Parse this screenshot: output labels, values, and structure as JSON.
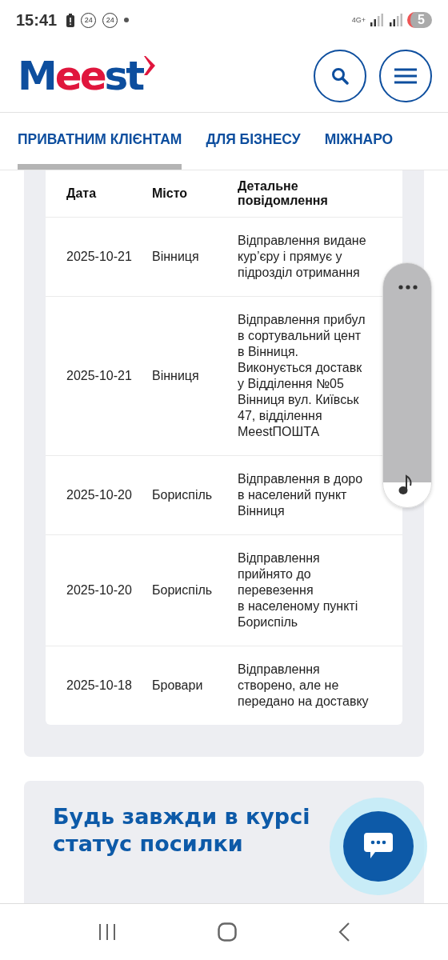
{
  "status_bar": {
    "time": "15:41",
    "badges": [
      "24",
      "24"
    ],
    "network": "4G+",
    "battery": "5"
  },
  "header": {
    "logo_parts": [
      "M",
      "ee",
      "st"
    ]
  },
  "nav_tabs": [
    {
      "label": "ПРИВАТНИМ КЛІЄНТАМ",
      "selected": true
    },
    {
      "label": "ДЛЯ БІЗНЕСУ",
      "selected": false
    },
    {
      "label": "МІЖНАРО",
      "selected": false
    }
  ],
  "table": {
    "columns": [
      "Дата",
      "Місто",
      "Детальне повідомлення"
    ],
    "rows": [
      {
        "date": "2025-10-21",
        "city": "Вінниця",
        "message": "Відправлення видане\nкур’єру і прямує у\nпідрозділ отримання"
      },
      {
        "date": "2025-10-21",
        "city": "Вінниця",
        "message": "Відправлення прибул\nв сортувальний цент\nв Вінниця.\nВиконується доставк\nу Відділення №05\nВінниця вул. Київськ\n47, відділення\nMeestПОШТА"
      },
      {
        "date": "2025-10-20",
        "city": "Бориспіль",
        "message": "Відправлення в доро\nв населений пункт\nВінниця"
      },
      {
        "date": "2025-10-20",
        "city": "Бориспіль",
        "message": "Відправлення\nприйнято до\nперевезення\nв населеному пункті\nБориспіль"
      },
      {
        "date": "2025-10-18",
        "city": "Бровари",
        "message": "Відправлення\nстворено, але не\nпередано на доставку"
      }
    ]
  },
  "news_card": {
    "heading": "Будь завжди в курсі\nстатус посилки"
  }
}
